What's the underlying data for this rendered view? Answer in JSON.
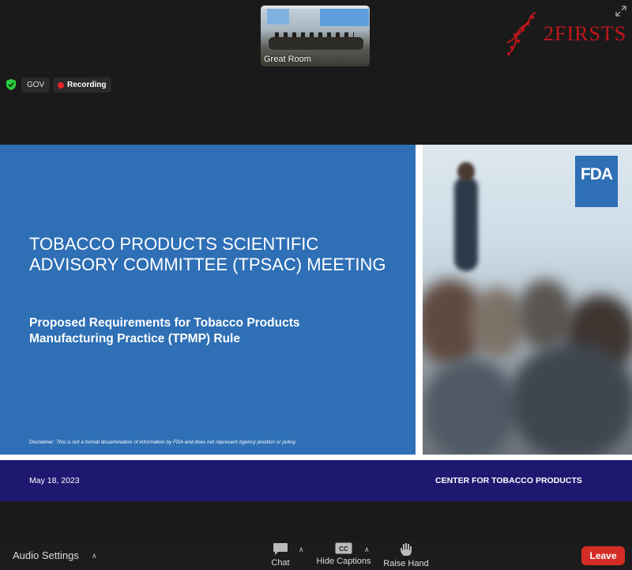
{
  "thumbnail": {
    "label": "Great Room"
  },
  "brand": {
    "logo_text": "2FIRSTS",
    "color": "#c0161c"
  },
  "status": {
    "gov_label": "GOV",
    "recording_label": "Recording"
  },
  "slide": {
    "logo_text": "FDA",
    "title": "TOBACCO PRODUCTS SCIENTIFIC ADVISORY COMMITTEE (TPSAC) MEETING",
    "subtitle": "Proposed Requirements for Tobacco Products Manufacturing Practice (TPMP) Rule",
    "disclaimer": "Disclaimer: This is not a formal dissemination of information by FDA and does not represent Agency position or policy.",
    "date": "May 18, 2023",
    "center": "CENTER FOR TOBACCO PRODUCTS",
    "colors": {
      "blue": "#2e6fb5",
      "footer": "#1e1870"
    }
  },
  "toolbar": {
    "audio_label": "Audio Settings",
    "chat_label": "Chat",
    "captions_label": "Hide Captions",
    "captions_icon_text": "CC",
    "raise_hand_label": "Raise Hand",
    "leave_label": "Leave",
    "leave_color": "#d42d25"
  }
}
